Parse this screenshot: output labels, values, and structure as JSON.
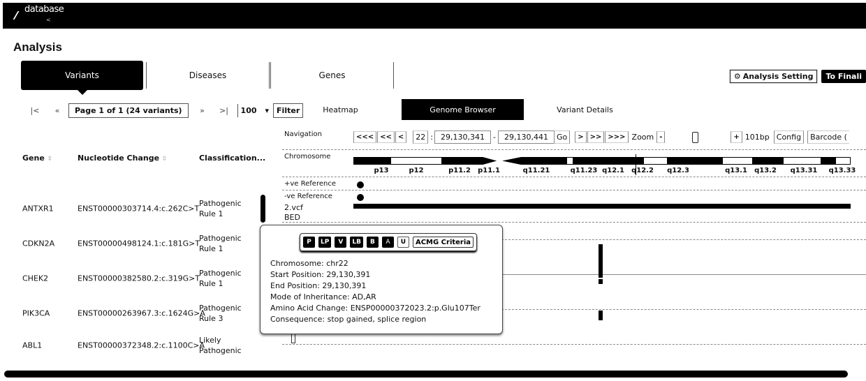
{
  "app": {
    "logo_text": "database",
    "logo_sub": "< ."
  },
  "page_title": "Analysis",
  "main_tabs": [
    {
      "label": "Variants",
      "active": true
    },
    {
      "label": "Diseases",
      "active": false
    },
    {
      "label": "Genes",
      "active": false
    }
  ],
  "actions": {
    "analysis_setting": "Analysis Setting",
    "to_final": "To Finali"
  },
  "pager": {
    "first": "|<",
    "prev": "«",
    "page_label": "Page 1 of 1 (24 variants)",
    "next": "»",
    "last": ">|",
    "per_page": "100",
    "per_page_caret": "▾",
    "filter": "Filter"
  },
  "table": {
    "headers": {
      "gene": "Gene",
      "nucleotide": "Nucleotide Change",
      "classification": "Classification..."
    },
    "sort_glyph": "⇳",
    "rows": [
      {
        "gene": "ANTXR1",
        "nucleotide": "ENST00000303714.4:c.262C>T",
        "class1": "Pathogenic",
        "class2": "Rule 1"
      },
      {
        "gene": "CDKN2A",
        "nucleotide": "ENST00000498124.1:c.181G>T",
        "class1": "Pathogenic",
        "class2": "Rule 1"
      },
      {
        "gene": "CHEK2",
        "nucleotide": "ENST00000382580.2:c.319G>T",
        "class1": "Pathogenic",
        "class2": "Rule 1"
      },
      {
        "gene": "PIK3CA",
        "nucleotide": "ENST00000263967.3:c.1624G>A",
        "class1": "Pathogenic",
        "class2": "Rule 3"
      },
      {
        "gene": "ABL1",
        "nucleotide": "ENST00000372348.2:c.1100C>A",
        "class1": "Likely",
        "class2": "Pathogenic"
      }
    ]
  },
  "sub_tabs": [
    {
      "label": "Heatmap",
      "active": false
    },
    {
      "label": "Genome Browser",
      "active": true
    },
    {
      "label": "Variant Details",
      "active": false
    }
  ],
  "browser": {
    "navigation_label": "Navigation",
    "chromosome_label": "Chromosome",
    "nav": {
      "back3": "<<<",
      "back2": "<<",
      "back1": "<",
      "chrom": "22",
      "colon": ":",
      "start": "29,130,341",
      "dash": "-",
      "end": "29,130,441",
      "go": "Go",
      "fwd1": ">",
      "fwd2": ">>",
      "fwd3": ">>>",
      "zoom_label": "Zoom",
      "zoom_out": "-",
      "zoom_in": "+",
      "span": "101bp",
      "config": "Config",
      "barcode": "Barcode ("
    },
    "bands": [
      "p13",
      "p12",
      "p11.2",
      "p11.1",
      "q11.21",
      "q11.23",
      "q12.1",
      "q12.2",
      "q12.3",
      "q13.1",
      "q13.2",
      "q13.31",
      "q13.33"
    ],
    "tracks": [
      "+ve Reference",
      "-ve Reference",
      "2.vcf",
      "BED"
    ]
  },
  "tooltip": {
    "acmg_buttons": [
      "P",
      "LP",
      "V",
      "LB",
      "B",
      "A",
      "U"
    ],
    "acmg_criteria": "ACMG Criteria",
    "lines": [
      "Chromosome: chr22",
      "Start Position: 29,130,391",
      "End Position: 29,130,391",
      "Mode of Inheritance: AD,AR",
      "Amino Acid Change: ENSP00000372023.2:p.Glu107Ter",
      "Consequence: stop gained, splice region"
    ]
  }
}
